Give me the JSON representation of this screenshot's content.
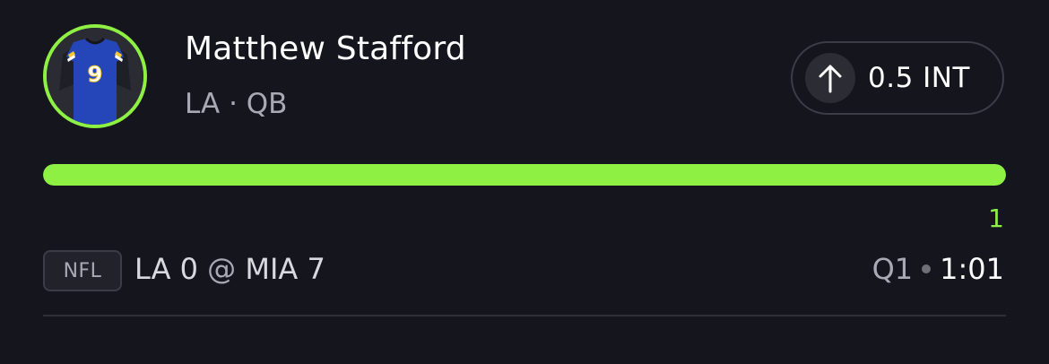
{
  "player": {
    "name": "Matthew Stafford",
    "team": "LA",
    "separator": "·",
    "position": "QB",
    "jersey_number": "9",
    "avatar_icon": "jersey-icon"
  },
  "pick": {
    "direction_icon": "arrow-up-icon",
    "label": "0.5 INT"
  },
  "progress": {
    "value_label": "1",
    "fraction": 1.0
  },
  "game": {
    "league": "NFL",
    "away_team": "LA",
    "away_score": "0",
    "at": "@",
    "home_team": "MIA",
    "home_score": "7",
    "quarter": "Q1",
    "clock": "1:01"
  },
  "colors": {
    "accent": "#8ef042",
    "background": "#15151d",
    "jersey_blue": "#2446b8",
    "jersey_gold": "#f5c731"
  }
}
